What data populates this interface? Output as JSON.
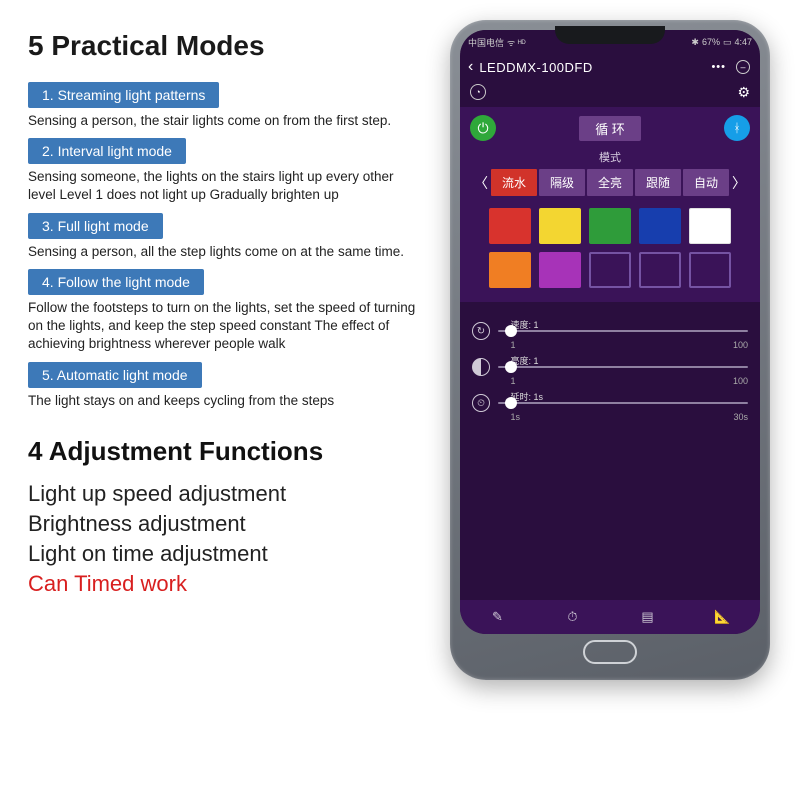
{
  "headings": {
    "modes": "5 Practical Modes",
    "functions": "4 Adjustment Functions"
  },
  "modes": [
    {
      "title": "1. Streaming light patterns",
      "desc": "Sensing a person, the stair lights come on from the first step."
    },
    {
      "title": "2. Interval light mode",
      "desc": "Sensing someone, the lights on the stairs light up every other level Level 1 does not light up Gradually brighten up"
    },
    {
      "title": "3. Full light mode",
      "desc": "Sensing a person, all the step lights come on at the same time."
    },
    {
      "title": "4. Follow the light mode",
      "desc": "Follow the footsteps to turn on the lights, set the speed of turning on the lights, and keep the step speed constant The effect of achieving brightness wherever people walk"
    },
    {
      "title": "5. Automatic light mode",
      "desc": "The light stays on and keeps cycling from the steps"
    }
  ],
  "functions": [
    "Light up speed adjustment",
    "Brightness adjustment",
    "Light on time adjustment",
    "Can Timed work"
  ],
  "phone": {
    "status": {
      "carrier": "中国电信",
      "signal": "ᯤ ᴴᴰ",
      "bt": "67%",
      "time": "4:47"
    },
    "topbar": {
      "back": "‹",
      "title": "LEDDMX-100DFD",
      "dots": "•••",
      "minus": "–"
    },
    "subbar": {
      "avatar": "◔",
      "gear": "⚙"
    },
    "mid": {
      "loop_label": "循 环",
      "mode_label": "模式",
      "arrow_l": "〈",
      "arrow_r": "〉",
      "tabs": [
        "流水",
        "隔级",
        "全亮",
        "跟随",
        "自动"
      ],
      "active_tab": 0,
      "colors": [
        "#d8332d",
        "#f3d631",
        "#2f9c3a",
        "#173eae",
        "#ffffff",
        "#f07e23",
        "#a733b8"
      ],
      "empty_count": 3
    },
    "sliders": [
      {
        "icon": "speed",
        "label": "速度:",
        "value": "1",
        "min": "1",
        "max": "100",
        "pos": 5
      },
      {
        "icon": "bright",
        "label": "亮度:",
        "value": "1",
        "min": "1",
        "max": "100",
        "pos": 5
      },
      {
        "icon": "time",
        "label": "延时:",
        "value": "1s",
        "min": "1s",
        "max": "30s",
        "pos": 5
      }
    ],
    "footer_icons": [
      "edit",
      "timer",
      "tabs",
      "angle"
    ]
  }
}
